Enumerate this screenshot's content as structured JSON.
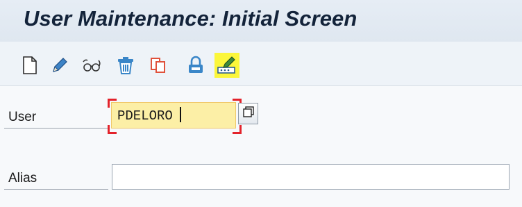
{
  "header": {
    "title": "User Maintenance: Initial Screen"
  },
  "toolbar": {
    "buttons": [
      {
        "name": "create",
        "icon": "new-document-icon"
      },
      {
        "name": "change",
        "icon": "pencil-icon"
      },
      {
        "name": "display",
        "icon": "glasses-icon"
      },
      {
        "name": "delete",
        "icon": "trash-icon"
      },
      {
        "name": "copy",
        "icon": "copy-icon"
      },
      {
        "name": "lock-unlock",
        "icon": "padlock-icon"
      },
      {
        "name": "change-password",
        "icon": "password-change-icon",
        "highlighted": true
      }
    ],
    "highlight_color": "#fbf63b"
  },
  "form": {
    "user": {
      "label": "User",
      "value": "PDELORO"
    },
    "alias": {
      "label": "Alias",
      "value": ""
    }
  },
  "colors": {
    "title_bar": "#dfe7f0",
    "input_focus_bg": "#fcefa6",
    "focus_corners": "#e3232b"
  }
}
